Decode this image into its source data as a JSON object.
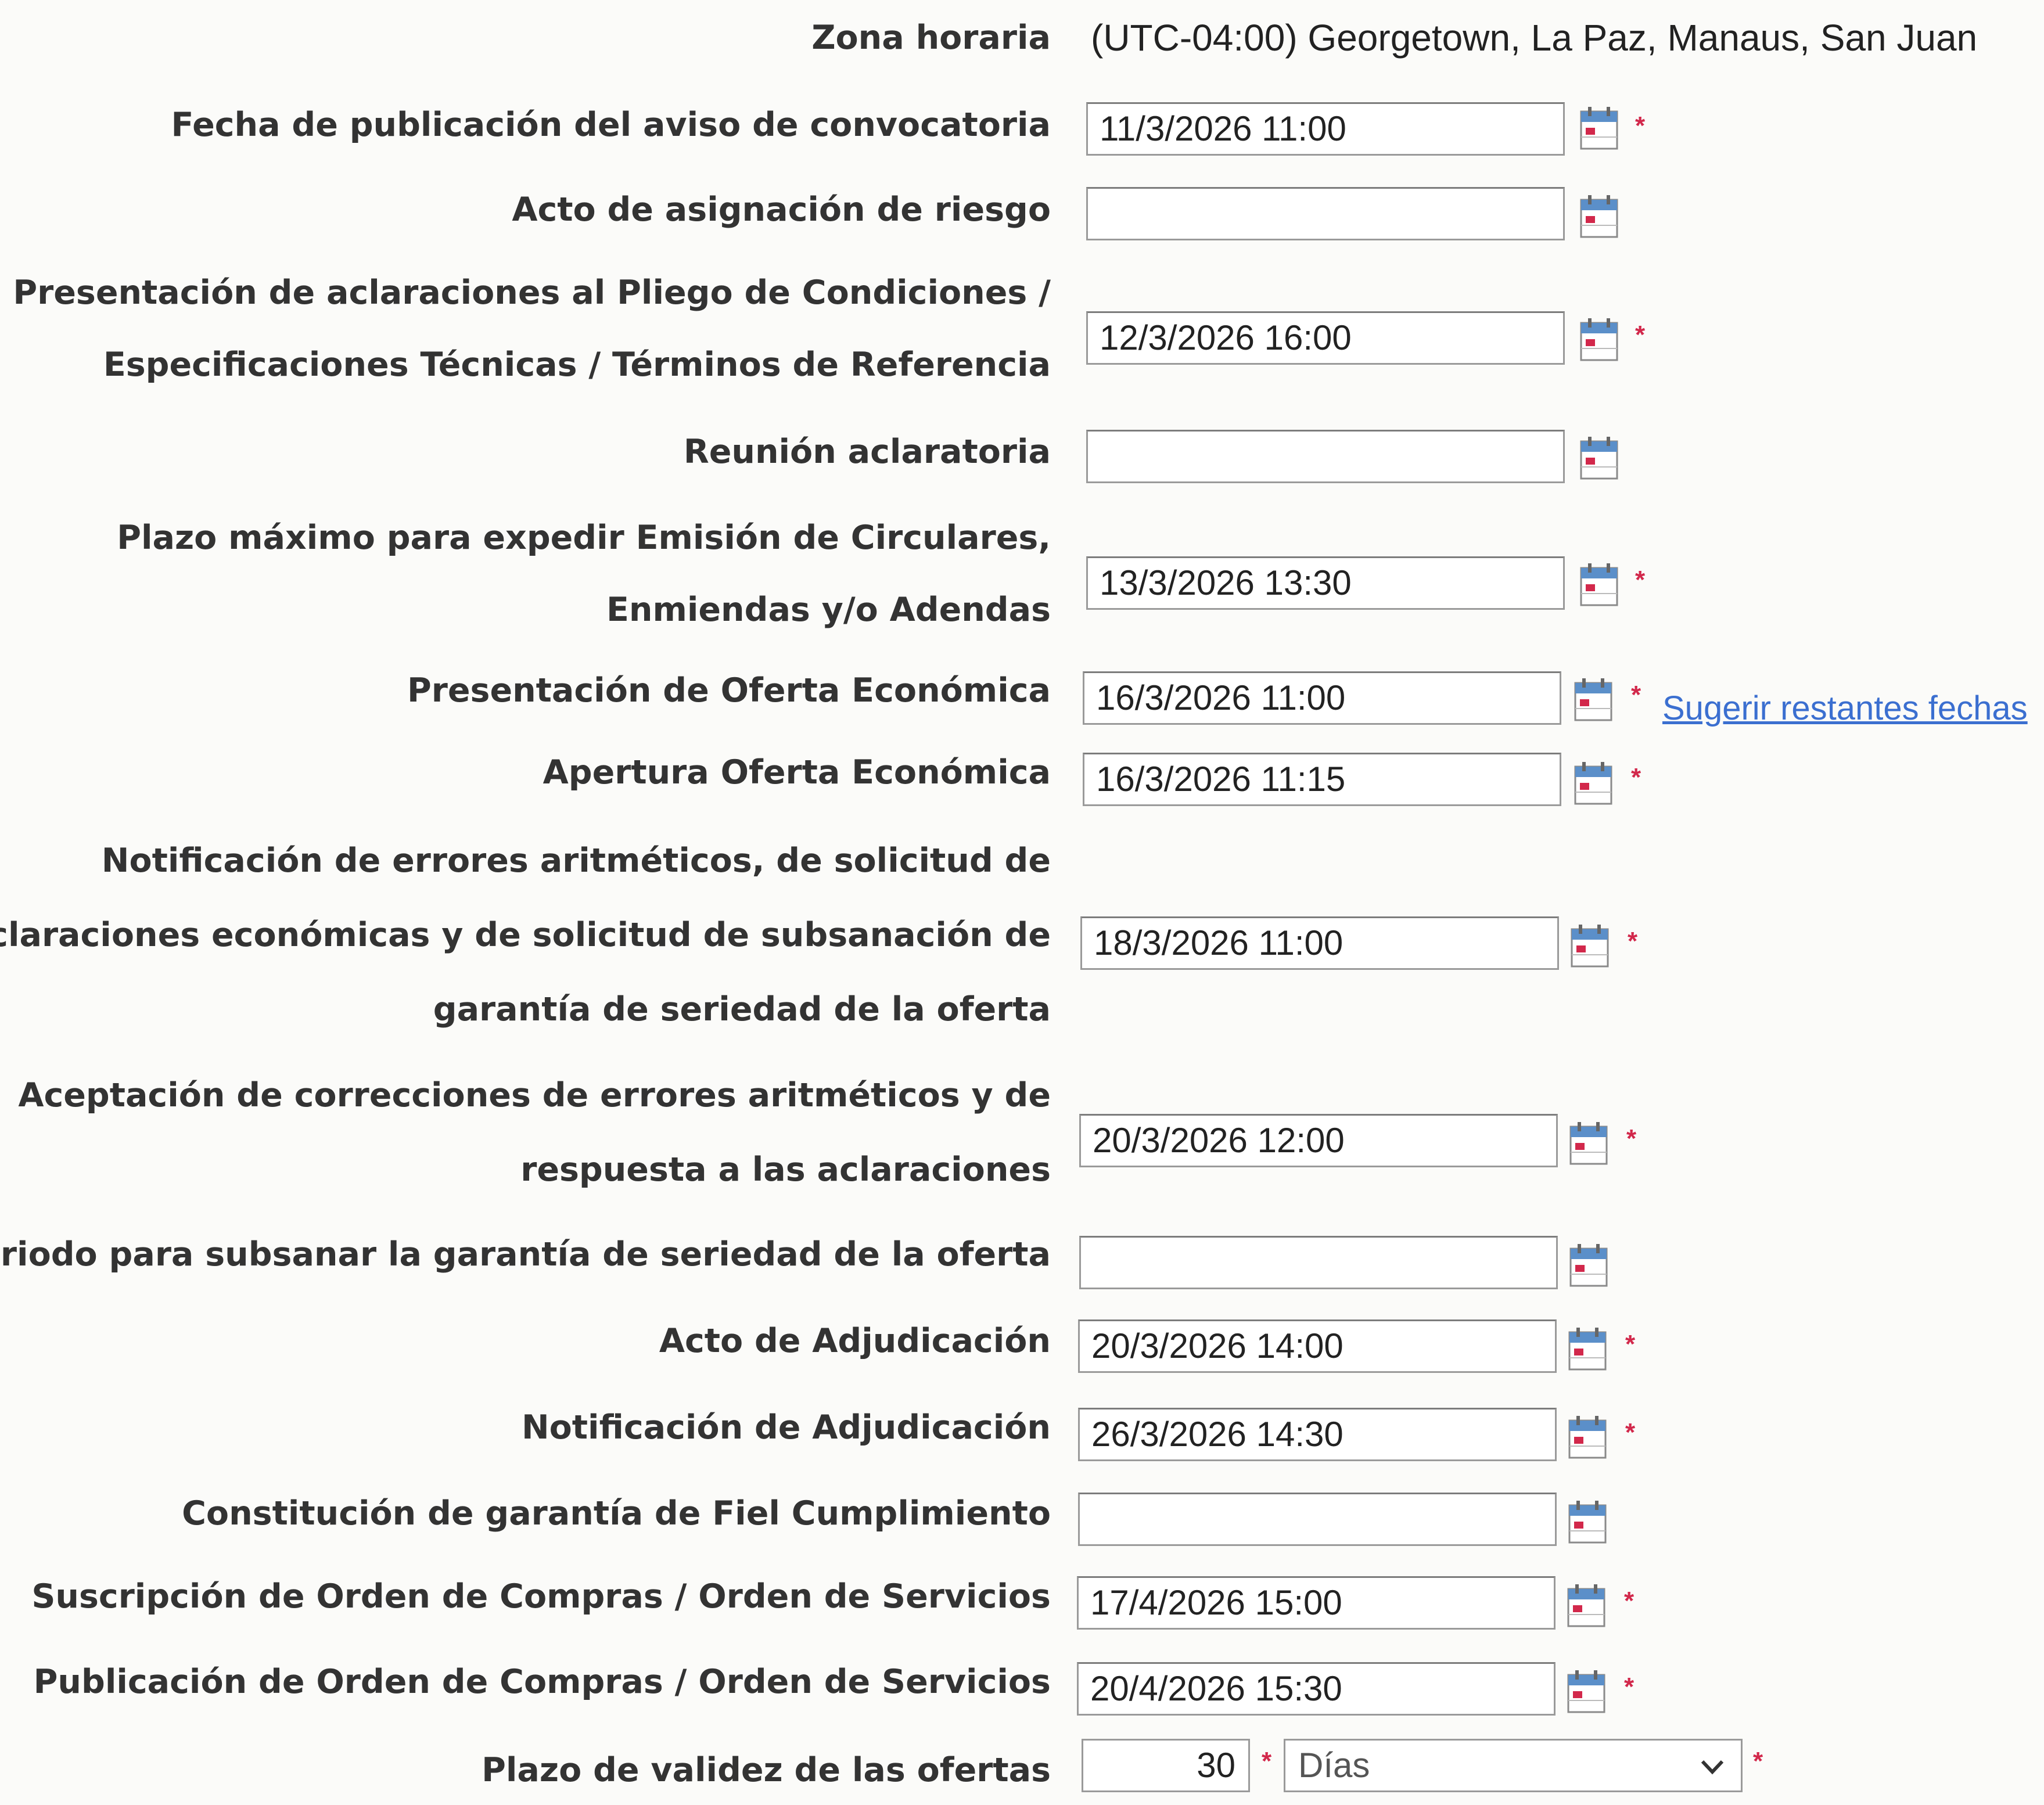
{
  "timezone": {
    "label": "Zona horaria",
    "value": "(UTC-04:00) Georgetown, La Paz, Manaus, San Juan"
  },
  "rows": [
    {
      "label1": "Fecha de publicación del aviso de convocatoria",
      "label2": "",
      "label3": "",
      "value": "11/3/2026 11:00",
      "required": "*"
    },
    {
      "label1": "Acto de asignación de riesgo",
      "label2": "",
      "label3": "",
      "value": "",
      "required": ""
    },
    {
      "label1": "Presentación de aclaraciones al Pliego de Condiciones /",
      "label2": "Especificaciones Técnicas / Términos de Referencia",
      "label3": "",
      "value": "12/3/2026 16:00",
      "required": "*"
    },
    {
      "label1": "Reunión aclaratoria",
      "label2": "",
      "label3": "",
      "value": "",
      "required": ""
    },
    {
      "label1": "Plazo máximo para expedir Emisión de Circulares,",
      "label2": "Enmiendas y/o Adendas",
      "label3": "",
      "value": "13/3/2026 13:30",
      "required": "*"
    },
    {
      "label1": "Presentación de Oferta Económica",
      "label2": "",
      "label3": "",
      "value": "16/3/2026 11:00",
      "required": "*",
      "link": "Sugerir restantes fechas"
    },
    {
      "label1": "Apertura Oferta Económica",
      "label2": "",
      "label3": "",
      "value": "16/3/2026 11:15",
      "required": "*"
    },
    {
      "label1": "Notificación de errores aritméticos, de solicitud de",
      "label2": "aclaraciones económicas y de solicitud de subsanación de",
      "label3": "garantía de seriedad de la oferta",
      "value": "18/3/2026 11:00",
      "required": "*"
    },
    {
      "label1": "Aceptación de correcciones de errores aritméticos y de",
      "label2": "respuesta a las aclaraciones",
      "label3": "",
      "value": "20/3/2026 12:00",
      "required": "*"
    },
    {
      "label1": "Periodo para subsanar la garantía de seriedad de la oferta",
      "label2": "",
      "label3": "",
      "value": "",
      "required": ""
    },
    {
      "label1": "Acto de Adjudicación",
      "label2": "",
      "label3": "",
      "value": "20/3/2026 14:00",
      "required": "*"
    },
    {
      "label1": "Notificación de Adjudicación",
      "label2": "",
      "label3": "",
      "value": "26/3/2026 14:30",
      "required": "*"
    },
    {
      "label1": "Constitución de garantía de Fiel Cumplimiento",
      "label2": "",
      "label3": "",
      "value": "",
      "required": ""
    },
    {
      "label1": "Suscripción de Orden de Compras / Orden de Servicios",
      "label2": "",
      "label3": "",
      "value": "17/4/2026 15:00",
      "required": "*"
    },
    {
      "label1": "Publicación de Orden de Compras / Orden de Servicios",
      "label2": "",
      "label3": "",
      "value": "20/4/2026 15:30",
      "required": "*"
    }
  ],
  "validity": {
    "label": "Plazo de validez de las ofertas",
    "number": "30",
    "required": "*",
    "unit": "Días",
    "unit_required": "*"
  },
  "colors": {
    "required": "#d2284b",
    "link": "#3b6fd0",
    "calendar": "#5b8fc9"
  },
  "icons": {
    "calendar": "calendar-icon",
    "dropdown": "chevron-down-icon"
  }
}
